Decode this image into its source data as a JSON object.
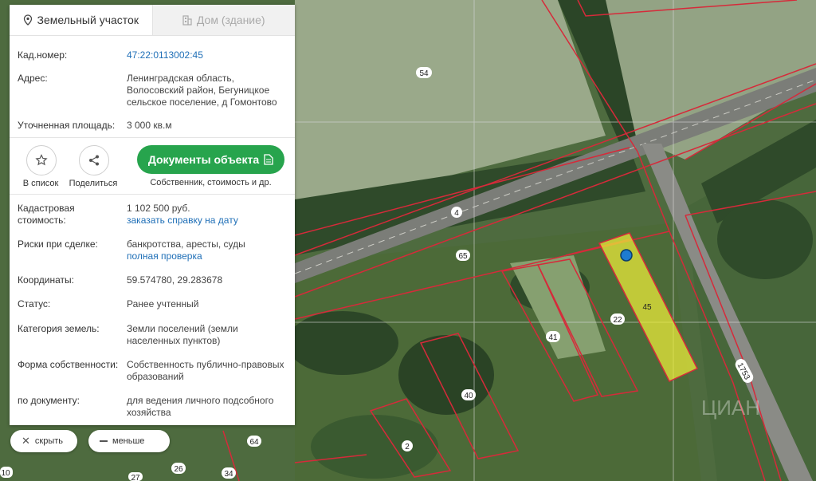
{
  "tabs": [
    {
      "label": "Земельный участок",
      "icon": "pin-icon",
      "active": true
    },
    {
      "label": "Дом (здание)",
      "icon": "building-icon",
      "active": false
    }
  ],
  "info": {
    "cad_label": "Кад.номер:",
    "cad_value": "47:22:0113002:45",
    "address_label": "Адрес:",
    "address_lines": [
      "Ленинградская область,",
      "Волосовский район, Бегуницкое",
      "сельское поселение, д Гомонтово"
    ],
    "area_label": "Уточненная площадь:",
    "area_value": "3 000 кв.м"
  },
  "actions": {
    "list_label": "В список",
    "share_label": "Поделиться",
    "docs_button": "Документы объекта",
    "docs_note": "Собственник, стоимость и др."
  },
  "details": {
    "cost_label_1": "Кадастровая",
    "cost_label_2": "стоимость:",
    "cost_value": "1 102 500 руб.",
    "cost_link": "заказать справку на дату",
    "risks_label": "Риски при сделке:",
    "risks_value": "банкротства, аресты, суды",
    "risks_link": "полная проверка",
    "coords_label": "Координаты:",
    "coords_value": "59.574780, 29.283678",
    "status_label": "Статус:",
    "status_value": "Ранее учтенный",
    "category_label": "Категория земель:",
    "category_lines": [
      "Земли поселений (земли",
      "населенных пунктов)"
    ],
    "ownership_label": "Форма собственности:",
    "ownership_lines": [
      "Собственность публично-правовых",
      "образований"
    ],
    "document_label": "по документу:",
    "document_lines": [
      "для ведения личного подсобного",
      "хозяйства"
    ]
  },
  "bottom": {
    "hide_label": "скрыть",
    "less_label": "меньше"
  },
  "map": {
    "parcel_labels": [
      "54",
      "4",
      "65",
      "41",
      "22",
      "45",
      "40",
      "2",
      "64",
      "26",
      "34",
      "27",
      "10",
      "1753"
    ],
    "watermark": "ЦИАН"
  },
  "colors": {
    "accent_green": "#27a44d",
    "link_blue": "#1f6fb7",
    "boundary_red": "#d62a3a",
    "parcel_yellow": "#e8ea3a"
  }
}
